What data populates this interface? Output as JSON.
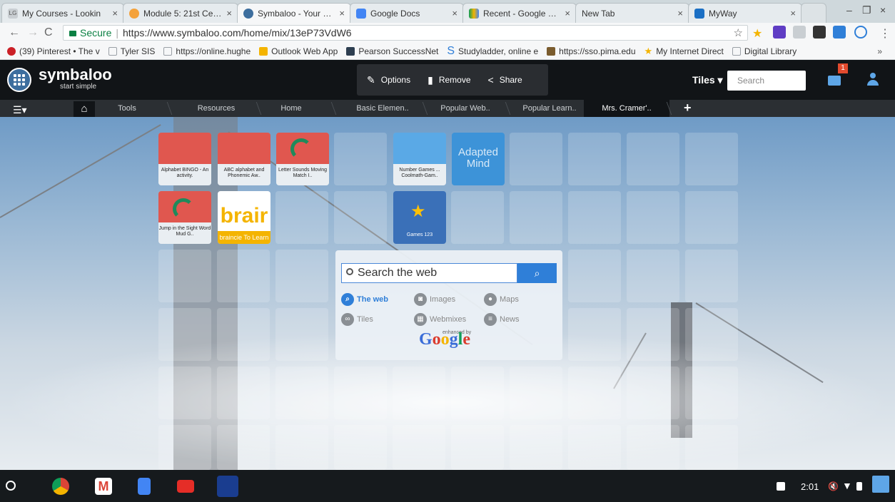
{
  "browser": {
    "tabs": [
      {
        "title": "My Courses - Lookin",
        "favicon": "LG"
      },
      {
        "title": "Module 5: 21st Centu",
        "favicon": "ring"
      },
      {
        "title": "Symbaloo - Your Boo",
        "favicon": "symbaloo"
      },
      {
        "title": "Google Docs",
        "favicon": "docs"
      },
      {
        "title": "Recent - Google Drive",
        "favicon": "drive"
      },
      {
        "title": "New Tab",
        "favicon": "none"
      },
      {
        "title": "MyWay",
        "favicon": "search"
      }
    ],
    "secure_label": "Secure",
    "url": "https://www.symbaloo.com/home/mix/13eP73VdW6",
    "bookmarks": [
      {
        "label": "(39) Pinterest • The v",
        "icon": "pinterest",
        "color": "#cb2027"
      },
      {
        "label": "Tyler SIS",
        "icon": "page",
        "color": "#9aa0a6"
      },
      {
        "label": "https://online.hughe",
        "icon": "page",
        "color": "#9aa0a6"
      },
      {
        "label": "Outlook Web App",
        "icon": "outlook",
        "color": "#f4b400"
      },
      {
        "label": "Pearson SuccessNet",
        "icon": "pearson",
        "color": "#2d3e50"
      },
      {
        "label": "Studyladder, online e",
        "icon": "studyladder",
        "color": "#2f7fd8"
      },
      {
        "label": "https://sso.pima.edu",
        "icon": "pima",
        "color": "#7a5c2e"
      },
      {
        "label": "My Internet Direct",
        "icon": "star",
        "color": "#f4b400"
      },
      {
        "label": "Digital Library",
        "icon": "page",
        "color": "#9aa0a6"
      }
    ],
    "bookmarks_more": "»"
  },
  "symbaloo": {
    "brand": "symbaloo",
    "tagline": "start simple",
    "actions": [
      {
        "label": "Options",
        "icon": "pencil-icon"
      },
      {
        "label": "Remove",
        "icon": "trash-icon"
      },
      {
        "label": "Share",
        "icon": "share-icon"
      }
    ],
    "tiles_dropdown": "Tiles ▾",
    "search_placeholder": "Search",
    "mail_badge": "1",
    "tabs": [
      "Tools",
      "Resources",
      "Home",
      "Basic Elemen..",
      "Popular Web..",
      "Popular Learn..",
      "Mrs. Cramer'.."
    ],
    "active_tab": "Mrs. Cramer'.."
  },
  "tiles": [
    {
      "label": "Alphabet BINGO - An activity.",
      "color": "#e0574f"
    },
    {
      "label": "ABC alphabet and Phonemic Aw..",
      "color": "#e0574f"
    },
    {
      "label": "Letter Sounds Moving Match I..",
      "color": "#e0574f"
    },
    {
      "label": "Number Games ... Coolmath-Gam..",
      "color": "#5aa9e6"
    },
    {
      "label": "Adapted Mind",
      "color": "#3d93d8"
    },
    {
      "label": "Jump in the Sight Word Mud G..",
      "color": "#e0574f"
    },
    {
      "label": "braincie To Learn",
      "color": "#ffffff"
    },
    {
      "label": "Games 123",
      "color": "#3a70b8"
    }
  ],
  "search_widget": {
    "placeholder": "Search the web",
    "options": [
      {
        "label": "The web",
        "icon": "magnifier-icon"
      },
      {
        "label": "Images",
        "icon": "camera-icon"
      },
      {
        "label": "Maps",
        "icon": "map-pin-icon"
      },
      {
        "label": "Tiles",
        "icon": "link-icon"
      },
      {
        "label": "Webmixes",
        "icon": "webmix-icon"
      },
      {
        "label": "News",
        "icon": "news-icon"
      }
    ],
    "enhanced_by": "enhanced by",
    "google": "Google"
  },
  "taskbar": {
    "clock": "2:01"
  }
}
